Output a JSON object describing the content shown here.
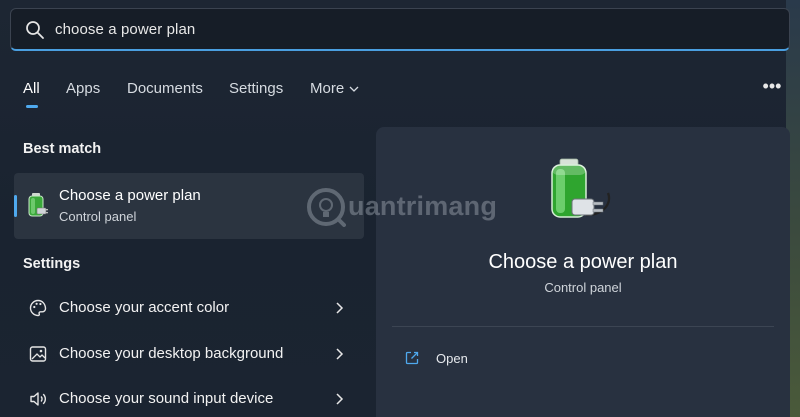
{
  "search": {
    "query": "choose a power plan"
  },
  "tabs": [
    {
      "label": "All",
      "active": true
    },
    {
      "label": "Apps"
    },
    {
      "label": "Documents"
    },
    {
      "label": "Settings"
    },
    {
      "label": "More"
    }
  ],
  "best_match": {
    "header": "Best match",
    "item": {
      "title": "Choose a power plan",
      "subtitle": "Control panel",
      "icon": "battery-plug-icon"
    }
  },
  "settings_section": {
    "header": "Settings",
    "items": [
      {
        "label": "Choose your accent color",
        "icon": "palette-icon"
      },
      {
        "label": "Choose your desktop background",
        "icon": "picture-icon"
      },
      {
        "label": "Choose your sound input device",
        "icon": "speaker-icon"
      }
    ]
  },
  "detail": {
    "title": "Choose a power plan",
    "subtitle": "Control panel",
    "actions": [
      {
        "label": "Open",
        "icon": "open-external-icon"
      }
    ]
  },
  "watermark": {
    "text": "uantrimang"
  },
  "colors": {
    "accent": "#4fa9ee",
    "background": "#1c2532",
    "pane": "#283140",
    "selected_row": "#2b3440"
  }
}
